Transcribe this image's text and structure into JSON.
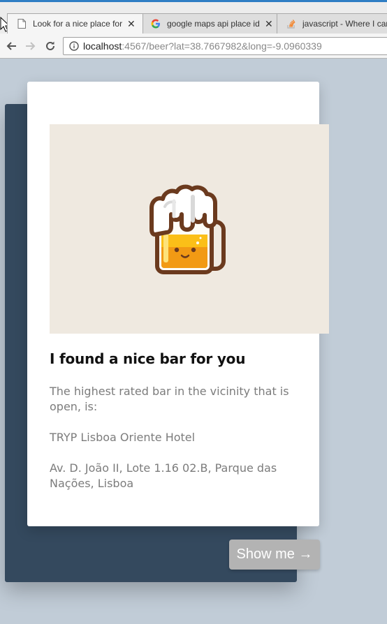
{
  "browser": {
    "tabs": [
      {
        "title": "Look for a nice place for",
        "favicon": "page-icon",
        "active": true
      },
      {
        "title": "google maps api place id",
        "favicon": "google-icon",
        "active": false
      },
      {
        "title": "javascript - Where I can",
        "favicon": "stackoverflow-icon",
        "active": false
      }
    ],
    "tab_close_glyph": "✕",
    "url_host": "localhost",
    "url_rest": ":4567/beer?lat=38.7667982&long=-9.0960339",
    "accent_color": "#2f7ec4"
  },
  "page": {
    "background_color": "#c1ccd7",
    "panel_color": "#34495e",
    "image_icon": "beer-mug-icon",
    "title": "I found a nice bar for you",
    "intro": "The highest rated bar in the vicinity that is open, is:",
    "bar_name": "TRYP Lisboa Oriente Hotel",
    "bar_address": "Av. D. João II, Lote 1.16 02.B, Parque das Nações, Lisboa",
    "button_label": "Show me →",
    "button_color": "#b3b3b3"
  }
}
